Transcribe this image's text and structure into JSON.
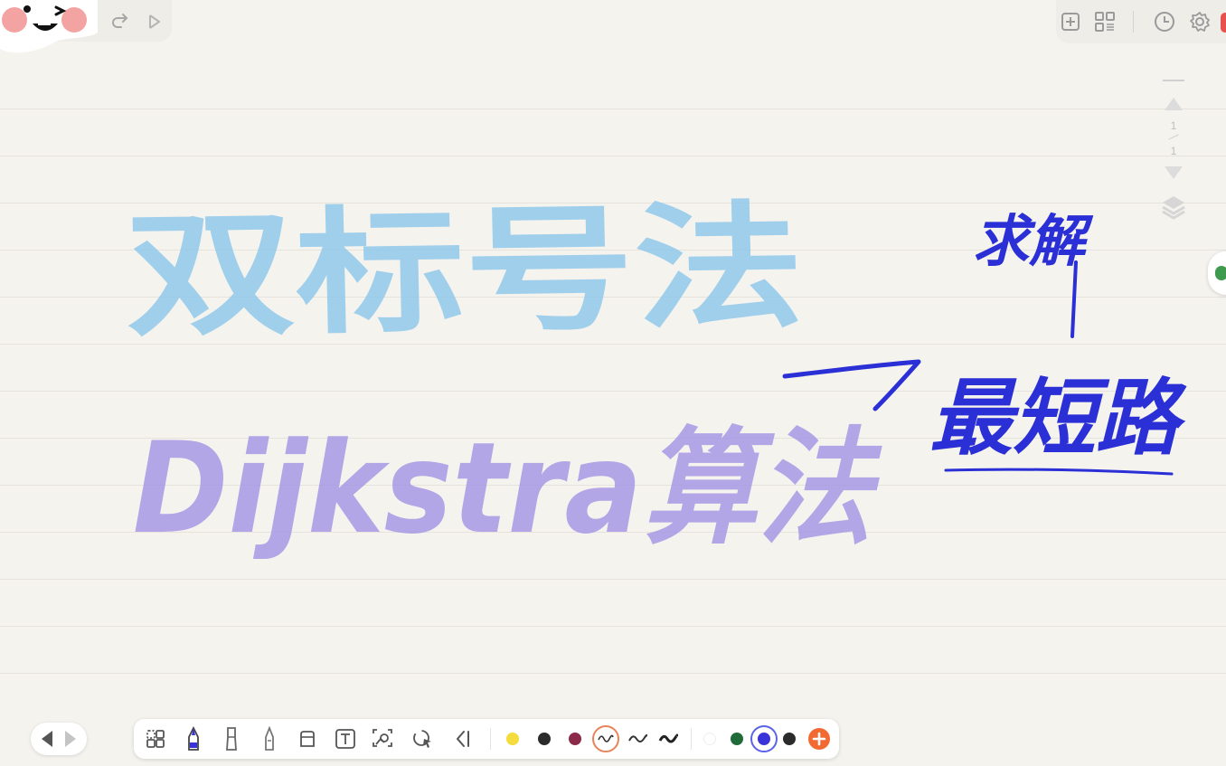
{
  "canvas": {
    "title_line1": "双标号法",
    "title_line2": "Dijkstra算法",
    "note_top": "求解",
    "note_main": "最短路"
  },
  "pager": {
    "current": "1",
    "total": "1"
  },
  "icons": {
    "top_left": [
      "mascot-icon",
      "redo-icon",
      "play-icon"
    ],
    "top_right": [
      "add-page-icon",
      "grid-icon",
      "history-icon",
      "settings-icon"
    ],
    "tools": [
      "lasso-select-icon",
      "fountain-pen-icon",
      "pencil-icon",
      "highlighter-icon",
      "eraser-icon",
      "text-box-icon",
      "image-icon",
      "shape-icon",
      "collapse-icon"
    ]
  },
  "colors": {
    "background": "#f5f3ee",
    "rule_line": "#e6e3dd",
    "ink_blue_light": "#8ec8ec",
    "ink_purple_light": "#a799e6",
    "ink_blue": "#2a2fd6",
    "swatches": [
      "#f4dc3c",
      "#2b2b2b",
      "#8c2a4a",
      "#ffffff",
      "#1f6b3a",
      "#3a33d8",
      "#2b2b2b",
      "#f26a32"
    ],
    "stroke_swatches": [
      "#333333",
      "#333333",
      "#222222"
    ],
    "selected_ring_stroke": "#e8845a",
    "selected_ring_color": "#5b63e6"
  }
}
